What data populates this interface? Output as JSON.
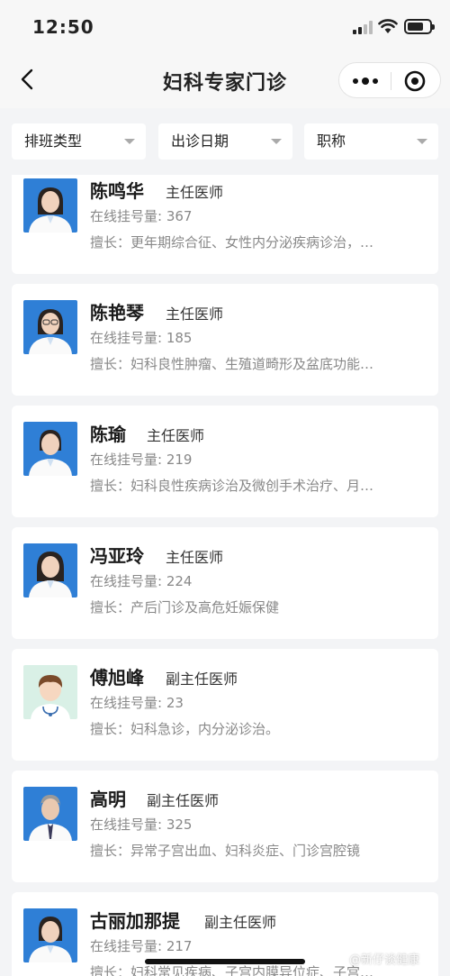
{
  "status": {
    "time": "12:50"
  },
  "nav": {
    "title": "妇科专家门诊"
  },
  "filters": [
    {
      "label": "排班类型"
    },
    {
      "label": "出诊日期"
    },
    {
      "label": "职称"
    }
  ],
  "doctors": [
    {
      "name": "陈鸣华",
      "title": "主任医师",
      "count": "在线挂号量: 367",
      "specialty": "擅长：更年期综合征、女性内分泌疾病诊治，…",
      "photo": "female-photo"
    },
    {
      "name": "陈艳琴",
      "title": "主任医师",
      "count": "在线挂号量: 185",
      "specialty": "擅长：妇科良性肿瘤、生殖道畸形及盆底功能…",
      "photo": "female-glasses-photo"
    },
    {
      "name": "陈瑜",
      "title": "主任医师",
      "count": "在线挂号量: 219",
      "specialty": "擅长：妇科良性疾病诊治及微创手术治疗、月…",
      "photo": "female-photo"
    },
    {
      "name": "冯亚玲",
      "title": "主任医师",
      "count": "在线挂号量: 224",
      "specialty": "擅长：产后门诊及高危妊娠保健",
      "photo": "female-photo"
    },
    {
      "name": "傅旭峰",
      "title": "副主任医师",
      "count": "在线挂号量: 23",
      "specialty": "擅长：妇科急诊，内分泌诊治。",
      "photo": "default-doctor-avatar"
    },
    {
      "name": "高明",
      "title": "副主任医师",
      "count": "在线挂号量: 325",
      "specialty": "擅长：异常子宫出血、妇科炎症、门诊宫腔镜",
      "photo": "male-photo"
    },
    {
      "name": "古丽加那提",
      "title": "副主任医师",
      "count": "在线挂号量: 217",
      "specialty": "擅长：妇科常见疾病、子宫内膜异位症、子宫…",
      "photo": "female-photo"
    }
  ],
  "watermark": "@新仔谈健康",
  "colors": {
    "photo_bg": "#2f7fd6",
    "default_avatar_bg": "#d9f0e6"
  }
}
